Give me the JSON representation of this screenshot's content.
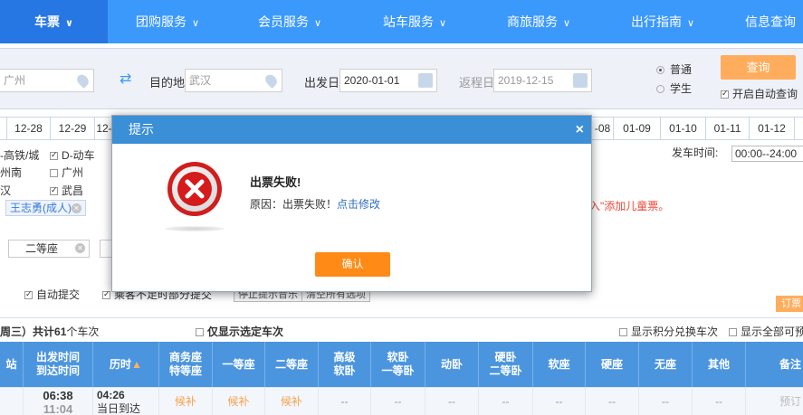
{
  "nav": {
    "items": [
      {
        "label": "车票",
        "active": true
      },
      {
        "label": "团购服务"
      },
      {
        "label": "会员服务"
      },
      {
        "label": "站车服务"
      },
      {
        "label": "商旅服务"
      },
      {
        "label": "出行指南"
      },
      {
        "label": "信息查询"
      }
    ]
  },
  "search": {
    "from_value": "广州",
    "to_label": "目的地",
    "to_value": "武汉",
    "depart_label": "出发日",
    "depart_value": "2020-01-01",
    "return_label": "返程日",
    "return_value": "2019-12-15",
    "radio_normal": "普通",
    "radio_student": "学生",
    "query_label": "查询",
    "auto_query_label": "开启自动查询"
  },
  "dates": [
    "12-28",
    "12-29",
    "12-",
    "-08",
    "01-09",
    "01-10",
    "01-11",
    "01-12"
  ],
  "filters": {
    "train_gc": "-高铁/城",
    "train_d": "D-动车",
    "station_a": "州南",
    "station_b": "广州",
    "station_c": "汉",
    "station_d": "武昌",
    "passenger": "王志勇(成人)",
    "seat": "二等座",
    "child_tip": "入\"添加儿童票。",
    "depart_time_label": "发车时间:",
    "depart_time_value": "00:00--24:00",
    "auto_submit": "自动提交",
    "partial_submit": "乘客不足时部分提交",
    "stop_music_btn": "停止提示音乐",
    "clear_btn": "清空所有选项",
    "order_btn": "订票"
  },
  "summary": {
    "prefix": "周三）共计",
    "count": "61",
    "suffix": "个车次",
    "only_selected": "仅显示选定车次",
    "points_exchange": "显示积分兑换车次",
    "show_all": "显示全部可预"
  },
  "table": {
    "headers": {
      "station": "站",
      "time_top": "出发时间",
      "time_bottom": "到达时间",
      "duration": "历时",
      "biz_top": "商务座",
      "biz_bottom": "特等座",
      "first": "一等座",
      "second": "二等座",
      "hsoft_top": "高级",
      "hsoft_bottom": "软卧",
      "soft_top": "软卧",
      "soft_bottom": "一等卧",
      "dong": "动卧",
      "hard_top": "硬卧",
      "hard_bottom": "二等卧",
      "softseat": "软座",
      "hardseat": "硬座",
      "noseat": "无座",
      "other": "其他",
      "remark": "备注"
    },
    "row": {
      "depart": "06:38",
      "arrive": "11:04",
      "duration": "04:26",
      "arrive_day": "当日到达",
      "biz": "候补",
      "first": "候补",
      "second": "候补",
      "dash": "--",
      "remark": "预订"
    }
  },
  "dialog": {
    "title": "提示",
    "close": "×",
    "heading": "出票失败!",
    "reason_prefix": "原因：出票失败！",
    "link": "点击修改",
    "ok": "确认"
  }
}
